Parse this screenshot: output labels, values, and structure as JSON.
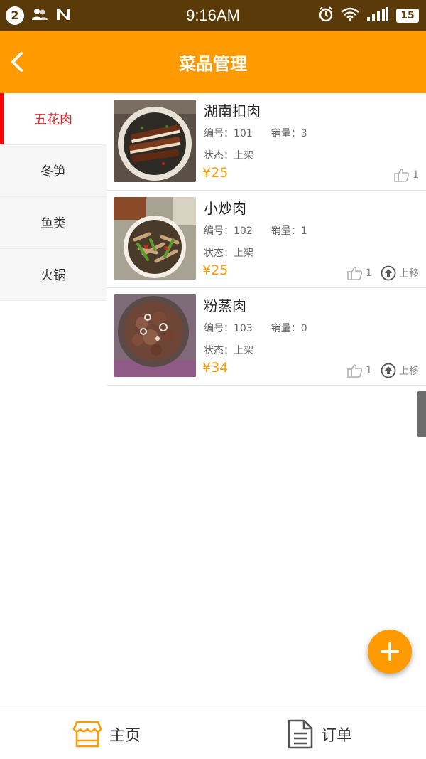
{
  "status_bar": {
    "notification_count": "2",
    "time": "9:16AM",
    "battery": "15",
    "icons": [
      "contacts-icon",
      "n-icon",
      "alarm-icon",
      "wifi-icon",
      "signal-icon",
      "battery-icon"
    ]
  },
  "app_bar": {
    "title": "菜品管理",
    "back_icon": "back-arrow-icon"
  },
  "colors": {
    "accent": "#ff9a00",
    "statusbar": "#5a3a08",
    "active_category": "#e8262b"
  },
  "categories": [
    {
      "label": "五花肉",
      "active": true
    },
    {
      "label": "冬笋",
      "active": false
    },
    {
      "label": "鱼类",
      "active": false
    },
    {
      "label": "火锅",
      "active": false
    }
  ],
  "dishes": [
    {
      "name": "湖南扣肉",
      "number": "编号：101",
      "sales": "销量：3",
      "status": "状态：上架",
      "price": "¥25",
      "likes": "1",
      "move_up": ""
    },
    {
      "name": "小炒肉",
      "number": "编号：102",
      "sales": "销量：1",
      "status": "状态：上架",
      "price": "¥25",
      "likes": "1",
      "move_up": "上移"
    },
    {
      "name": "粉蒸肉",
      "number": "编号：103",
      "sales": "销量：0",
      "status": "状态：上架",
      "price": "¥34",
      "likes": "1",
      "move_up": "上移"
    }
  ],
  "fab": {
    "icon": "plus-icon"
  },
  "bottom_tabs": [
    {
      "label": "主页",
      "icon": "store-icon"
    },
    {
      "label": "订单",
      "icon": "document-icon"
    }
  ]
}
